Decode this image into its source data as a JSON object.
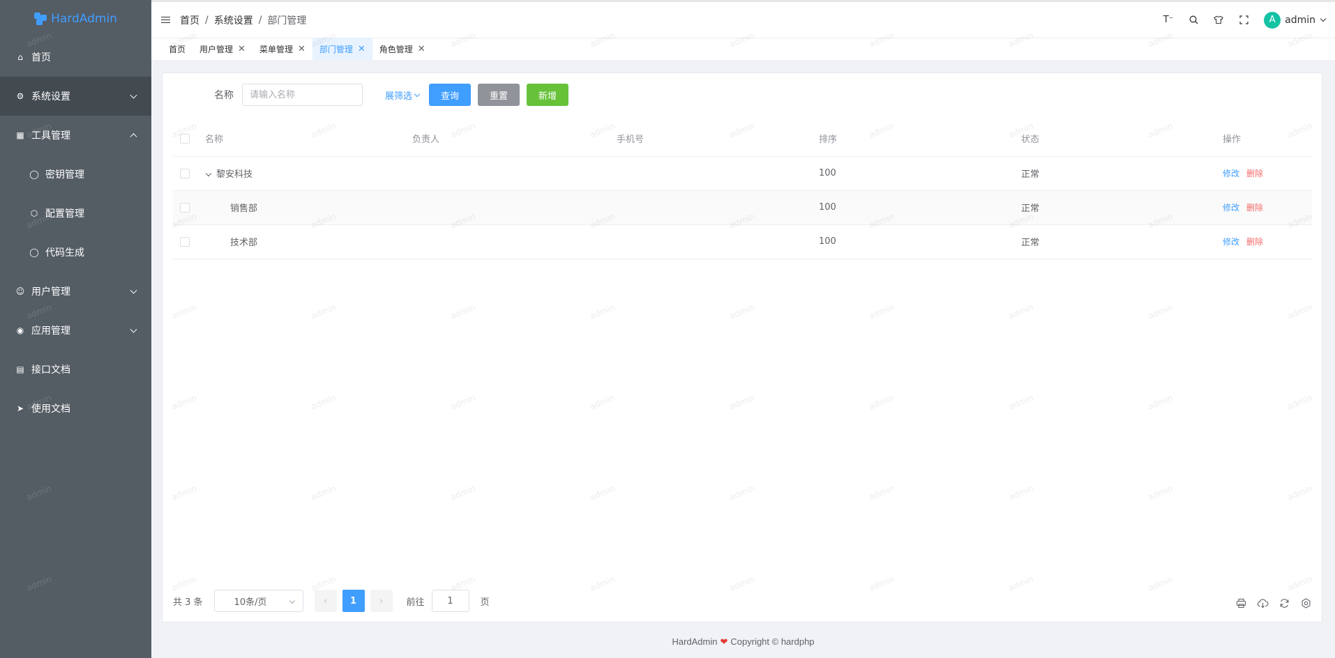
{
  "app": {
    "name": "HardAdmin"
  },
  "sidebar": {
    "items": [
      {
        "label": "首页",
        "icon": "home-icon",
        "has_children": false,
        "expanded": false,
        "active": false,
        "sub": false
      },
      {
        "label": "系统设置",
        "icon": "gear-icon",
        "has_children": true,
        "expanded": false,
        "active": true,
        "sub": false
      },
      {
        "label": "工具管理",
        "icon": "grid-icon",
        "has_children": true,
        "expanded": true,
        "active": false,
        "sub": false
      },
      {
        "label": "密钥管理",
        "icon": "key-icon",
        "has_children": false,
        "expanded": false,
        "active": false,
        "sub": true
      },
      {
        "label": "配置管理",
        "icon": "config-icon",
        "has_children": false,
        "expanded": false,
        "active": false,
        "sub": true
      },
      {
        "label": "代码生成",
        "icon": "code-icon",
        "has_children": false,
        "expanded": false,
        "active": false,
        "sub": true
      },
      {
        "label": "用户管理",
        "icon": "user-icon",
        "has_children": true,
        "expanded": false,
        "active": false,
        "sub": false
      },
      {
        "label": "应用管理",
        "icon": "broadcast-icon",
        "has_children": true,
        "expanded": false,
        "active": false,
        "sub": false
      },
      {
        "label": "接口文档",
        "icon": "chart-icon",
        "has_children": false,
        "expanded": false,
        "active": false,
        "sub": false
      },
      {
        "label": "使用文档",
        "icon": "rocket-icon",
        "has_children": false,
        "expanded": false,
        "active": false,
        "sub": false
      }
    ]
  },
  "header": {
    "breadcrumb": [
      "首页",
      "系统设置",
      "部门管理"
    ],
    "breadcrumb_sep": "/",
    "user": {
      "avatar_letter": "A",
      "name": "admin"
    }
  },
  "tabs": [
    {
      "label": "首页",
      "closable": false,
      "active": false
    },
    {
      "label": "用户管理",
      "closable": true,
      "active": false
    },
    {
      "label": "菜单管理",
      "closable": true,
      "active": false
    },
    {
      "label": "部门管理",
      "closable": true,
      "active": true
    },
    {
      "label": "角色管理",
      "closable": true,
      "active": false
    }
  ],
  "filter": {
    "name_label": "名称",
    "name_placeholder": "请输入名称",
    "name_value": "",
    "expand_label": "展筛选",
    "search_label": "查询",
    "reset_label": "重置",
    "add_label": "新增"
  },
  "table": {
    "columns": [
      "名称",
      "负责人",
      "手机号",
      "排序",
      "状态",
      "操作"
    ],
    "rows": [
      {
        "name": "黎安科技",
        "leader": "",
        "phone": "",
        "sort": "100",
        "status": "正常",
        "level": 0,
        "expandable": true
      },
      {
        "name": "销售部",
        "leader": "",
        "phone": "",
        "sort": "100",
        "status": "正常",
        "level": 1,
        "expandable": false
      },
      {
        "name": "技术部",
        "leader": "",
        "phone": "",
        "sort": "100",
        "status": "正常",
        "level": 1,
        "expandable": false
      }
    ],
    "edit_label": "修改",
    "delete_label": "删除"
  },
  "pagination": {
    "total_text": "共 3 条",
    "page_size": "10条/页",
    "current_page": "1",
    "goto_label": "前往",
    "goto_value": "1",
    "page_suffix": "页"
  },
  "footer": {
    "brand": "HardAdmin",
    "copyright": "Copyright © hardphp"
  },
  "watermark": "admin",
  "colors": {
    "sidebar_bg": "#545c64",
    "primary": "#409eff",
    "info": "#909399",
    "success": "#67c23a",
    "danger": "#f56c6c"
  }
}
